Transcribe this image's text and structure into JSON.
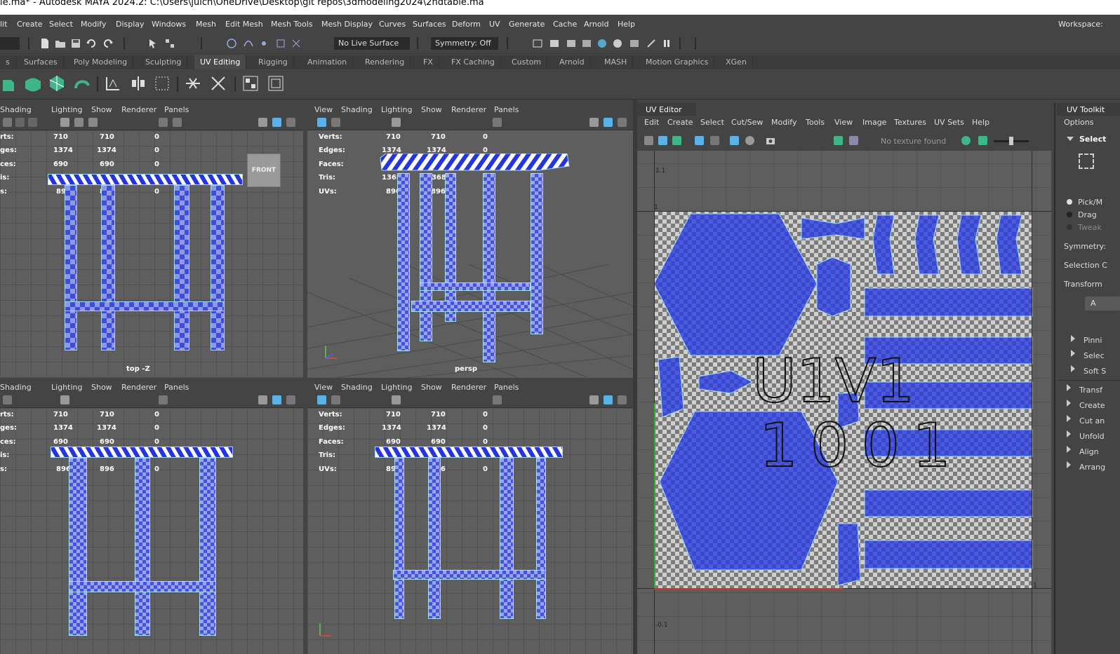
{
  "window_title": "le.ma* - Autodesk MAYA 2024.2: C:\\Users\\julch\\OneDrive\\Desktop\\git repos\\3dmodeling2024\\2ndtable.ma",
  "menubar": {
    "items": [
      "lit",
      "Create",
      "Select",
      "Modify",
      "Display",
      "Windows",
      "Mesh",
      "Edit Mesh",
      "Mesh Tools",
      "Mesh Display",
      "Curves",
      "Surfaces",
      "Deform",
      "UV",
      "Generate",
      "Cache",
      "Arnold",
      "Help"
    ],
    "workspace_label": "Workspace:"
  },
  "statusline": {
    "live_surface": "No Live Surface",
    "symmetry": "Symmetry: Off"
  },
  "shelf_tabs": {
    "items": [
      "s",
      "Surfaces",
      "Poly Modeling",
      "Sculpting",
      "UV Editing",
      "Rigging",
      "Animation",
      "Rendering",
      "FX",
      "FX Caching",
      "Custom",
      "Arnold",
      "MASH",
      "Motion Graphics",
      "XGen"
    ],
    "active": "UV Editing"
  },
  "viewport_menu": [
    "View",
    "Shading",
    "Lighting",
    "Show",
    "Renderer",
    "Panels"
  ],
  "viewport_menu_cut": [
    "Shading",
    "Lighting",
    "Show",
    "Renderer",
    "Panels"
  ],
  "hud": {
    "labels_full": [
      "Verts:",
      "Edges:",
      "Faces:",
      "Tris:",
      "UVs:"
    ],
    "labels_cut": [
      "rts:",
      "ges:",
      "ces:",
      "is:",
      "s:"
    ],
    "col1": [
      "710",
      "1374",
      "690",
      "1368",
      "896"
    ],
    "col2": [
      "710",
      "1374",
      "690",
      "1368",
      "896"
    ],
    "col3": [
      "0",
      "0",
      "0",
      "0",
      "0"
    ]
  },
  "viewports": {
    "top_left": {
      "camera": "top -Z",
      "cube_label": "FRONT"
    },
    "top_right": {
      "camera": "persp"
    }
  },
  "uv_editor": {
    "title": "UV Editor",
    "menu": [
      "Edit",
      "Create",
      "Select",
      "Cut/Sew",
      "Modify",
      "Tools",
      "View",
      "Image",
      "Textures",
      "UV Sets",
      "Help"
    ],
    "texture_status": "No texture found",
    "axis_labels": {
      "top": "1.1",
      "one": "1",
      "neg": "-0.1",
      "right": "1"
    },
    "udim_label_line1": "U1V1",
    "udim_label_line2": "1001"
  },
  "uv_toolkit": {
    "title": "UV Toolkit",
    "options": "Options",
    "select_header": "Select",
    "radios": [
      "Pick/M",
      "Drag",
      "Tweak"
    ],
    "symmetry": "Symmetry:",
    "selection": "Selection C",
    "transform_label": "Transform",
    "button_a": "A",
    "subsections": [
      "Pinni",
      "Selec",
      "Soft S"
    ],
    "sections": [
      "Transf",
      "Create",
      "Cut an",
      "Unfold",
      "Align",
      "Arrang"
    ]
  },
  "colors": {
    "ui_bg": "#444444",
    "viewport_bg": "#5e5e5e",
    "uv_blue": "#3d4ed8",
    "active_green": "#3fb58a",
    "selection_cyan": "#9fd8ff"
  }
}
